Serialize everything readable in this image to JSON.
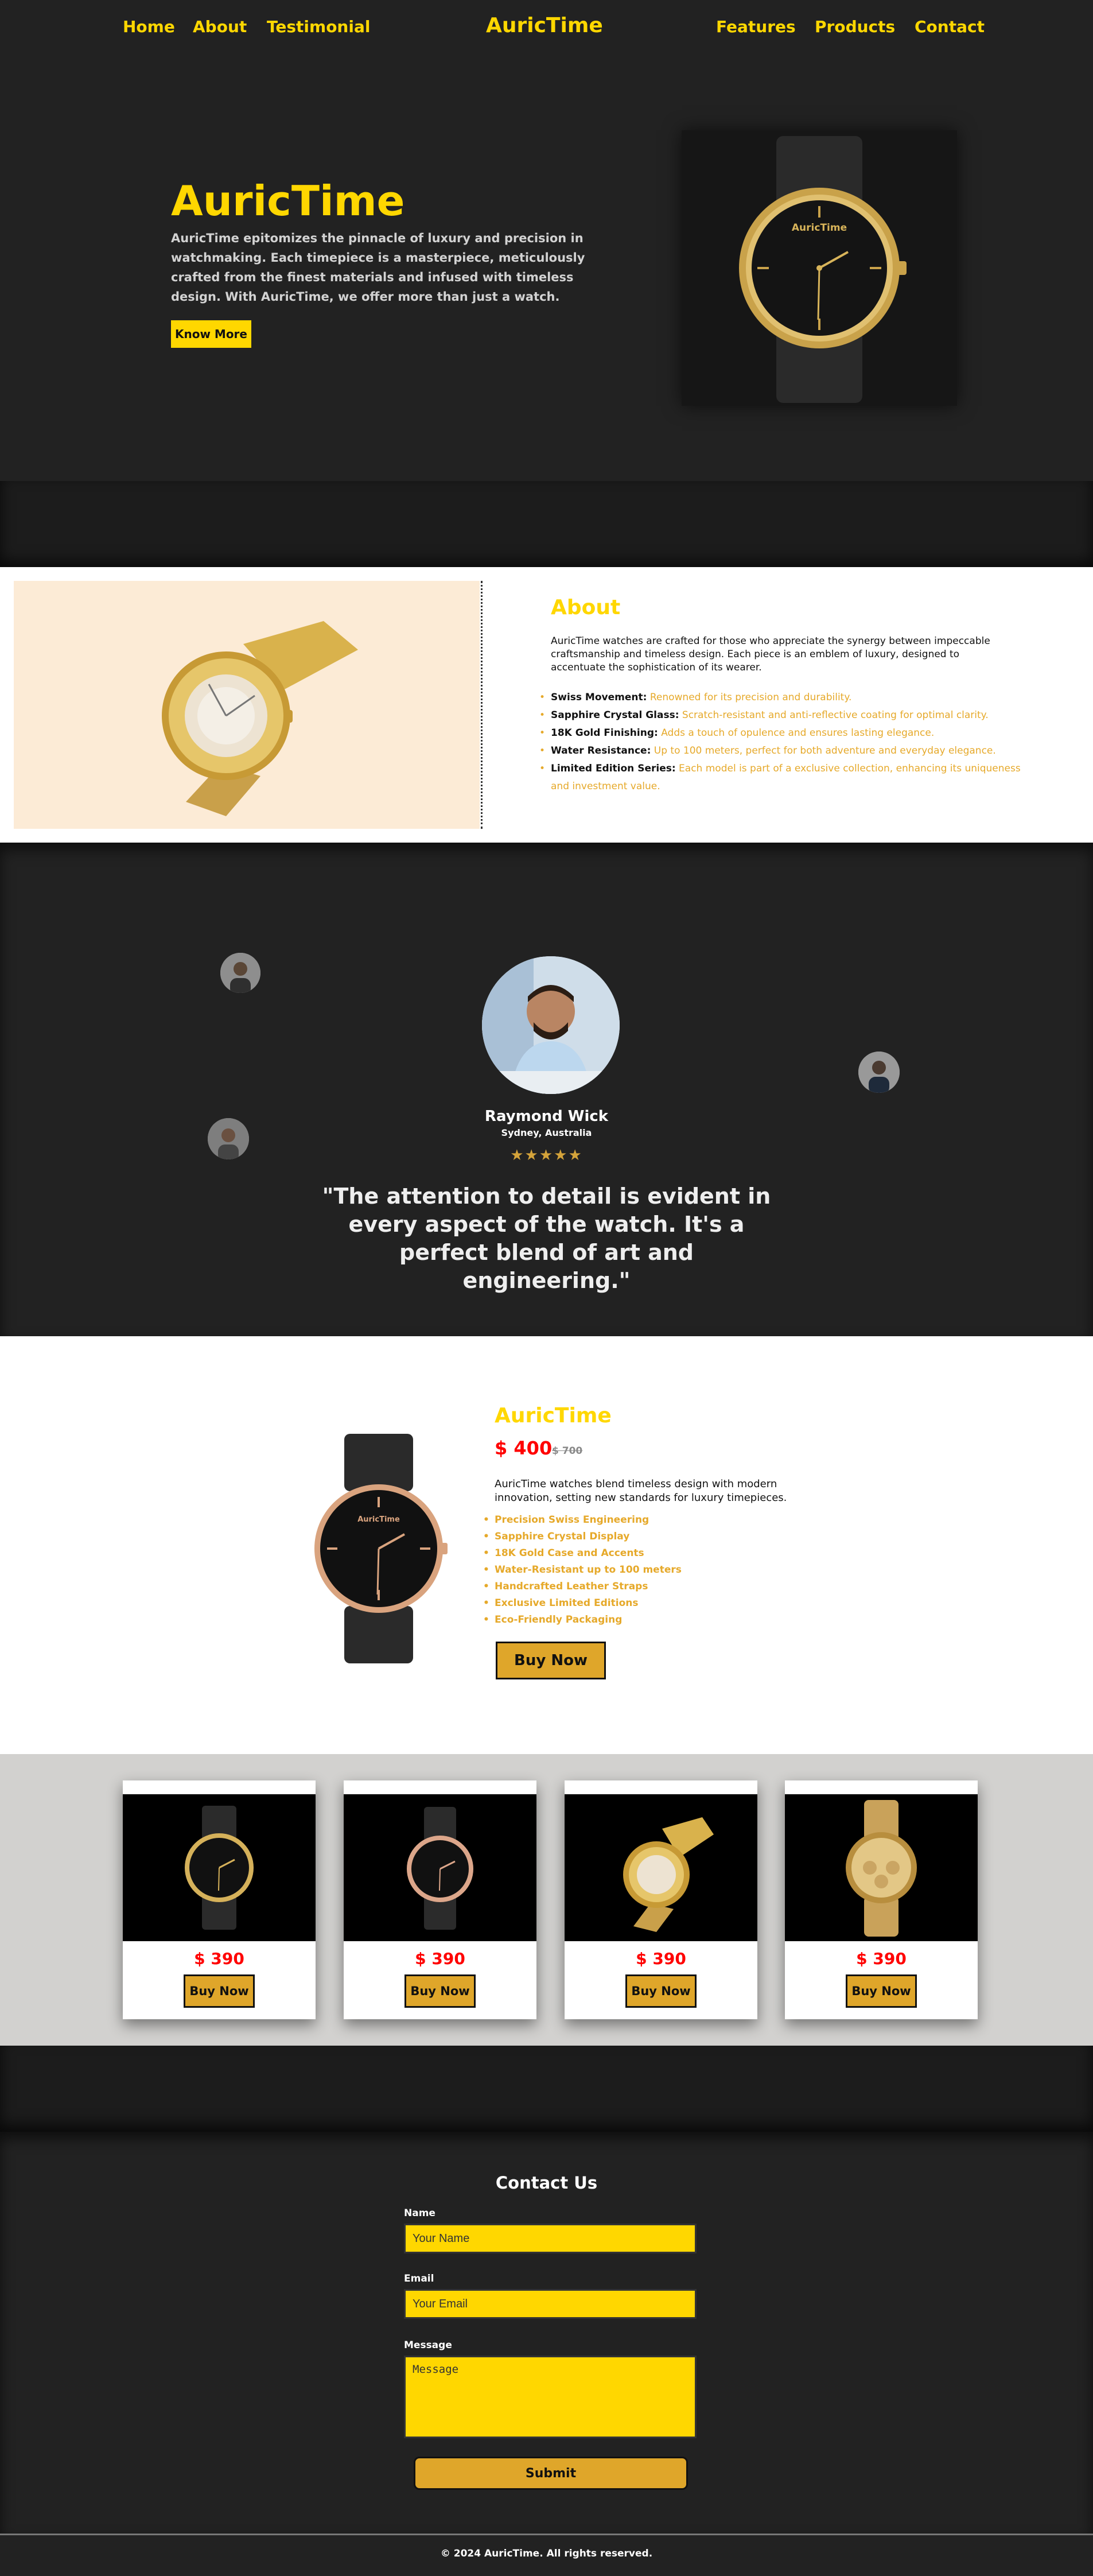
{
  "nav": {
    "links_left": [
      "Home",
      "About",
      "Testimonial"
    ],
    "brand": "AuricTime",
    "links_right": [
      "Features",
      "Products",
      "Contact"
    ]
  },
  "hero": {
    "title": "AuricTime",
    "text": "AuricTime epitomizes the pinnacle of luxury and precision in watchmaking. Each timepiece is a masterpiece, meticulously crafted from the finest materials and infused with timeless design. With AuricTime, we offer more than just a watch.",
    "button": "Know More",
    "watch_brand": "AuricTime"
  },
  "about": {
    "title": "About",
    "desc": "AuricTime watches are crafted for those who appreciate the synergy between impeccable craftsmanship and timeless design. Each piece is an emblem of luxury, designed to accentuate the sophistication of its wearer.",
    "items": [
      {
        "label": "Swiss Movement:",
        "text": "Renowned for its precision and durability."
      },
      {
        "label": "Sapphire Crystal Glass:",
        "text": "Scratch-resistant and anti-reflective coating for optimal clarity."
      },
      {
        "label": "18K Gold Finishing:",
        "text": "Adds a touch of opulence and ensures lasting elegance."
      },
      {
        "label": "Water Resistance:",
        "text": "Up to 100 meters, perfect for both adventure and everyday elegance."
      },
      {
        "label": "Limited Edition Series:",
        "text": "Each model is part of a exclusive collection, enhancing its uniqueness and investment value."
      }
    ]
  },
  "testimonial": {
    "name": "Raymond Wick",
    "location": "Sydney, Australia",
    "stars": "★★★★★",
    "rating": 4.5,
    "quote": "\"The attention to detail is evident in every aspect of the watch. It's a perfect blend of art and engineering.\""
  },
  "product": {
    "title": "AuricTime",
    "price": "$ 400",
    "old_price": "$ 700",
    "desc": "AuricTime watches blend timeless design with modern innovation, setting new standards for luxury timepieces.",
    "features": [
      "Precision Swiss Engineering",
      "Sapphire Crystal Display",
      "18K Gold Case and Accents",
      "Water-Resistant up to 100 meters",
      "Handcrafted Leather Straps",
      "Exclusive Limited Editions",
      "Eco-Friendly Packaging"
    ],
    "button": "Buy Now",
    "watch_brand": "AuricTime"
  },
  "cards": [
    {
      "price": "$ 390",
      "button": "Buy Now"
    },
    {
      "price": "$ 390",
      "button": "Buy Now"
    },
    {
      "price": "$ 390",
      "button": "Buy Now"
    },
    {
      "price": "$ 390",
      "button": "Buy Now"
    }
  ],
  "contact": {
    "title": "Contact Us",
    "name_label": "Name",
    "name_placeholder": "Your Name",
    "email_label": "Email",
    "email_placeholder": "Your Email",
    "message_label": "Message",
    "message_placeholder": "Message",
    "submit": "Submit"
  },
  "footer": {
    "text": "© 2024 AuricTime. All rights reserved."
  },
  "colors": {
    "accent": "#ffd700",
    "button": "#dfa62a",
    "price": "#ff0000",
    "background": "#222222"
  }
}
